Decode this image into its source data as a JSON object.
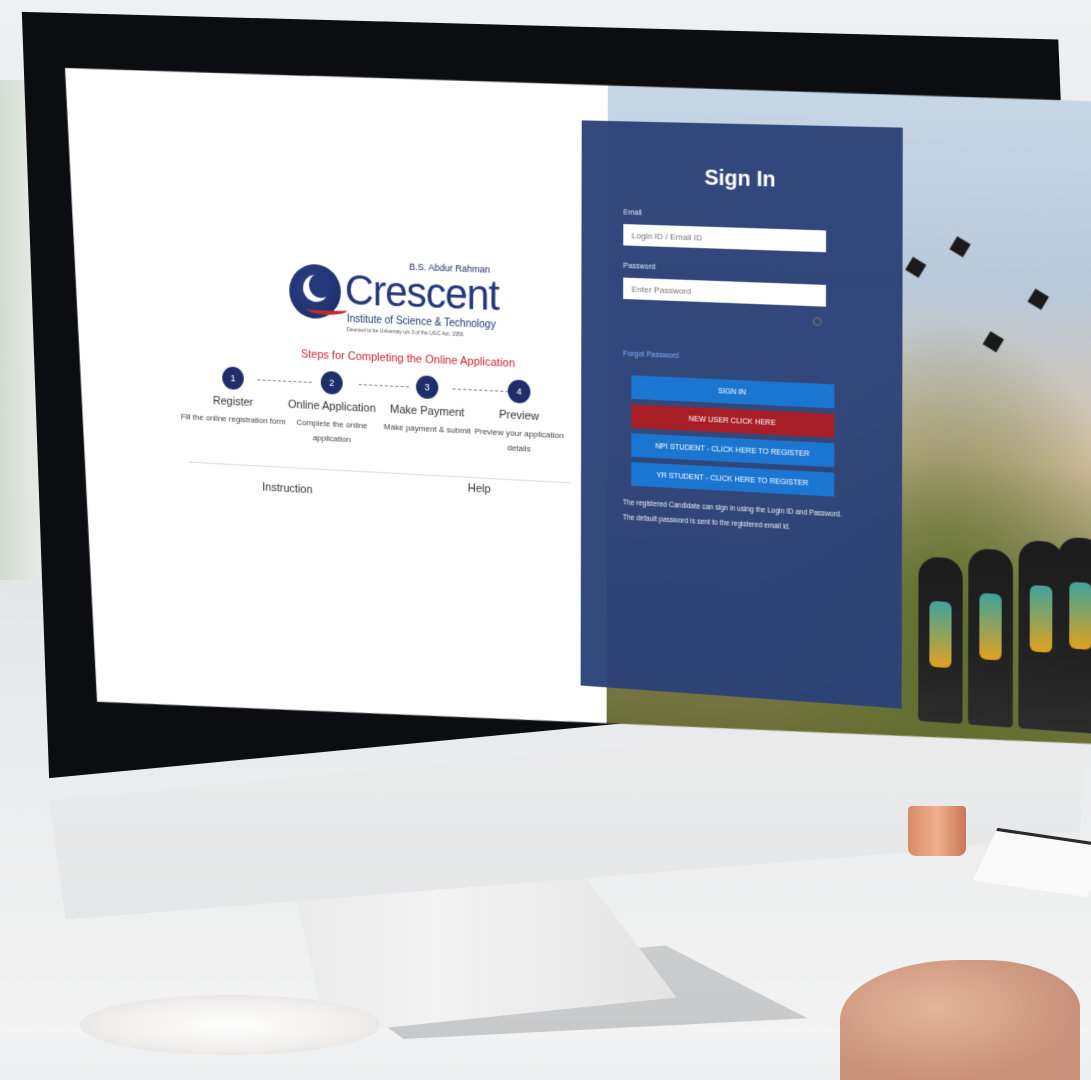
{
  "left": {
    "logo": {
      "top_line": "B.S. Abdur Rahman",
      "name": "Crescent",
      "subtitle": "Institute of Science & Technology",
      "deemed": "Deemed to be University u/s 3 of the UGC Act, 1956"
    },
    "steps_heading": "Steps for Completing the Online Application",
    "steps": [
      {
        "number": "1",
        "title": "Register",
        "desc": "Fill the online registration form"
      },
      {
        "number": "2",
        "title": "Online Application",
        "desc": "Complete the online application"
      },
      {
        "number": "3",
        "title": "Make Payment",
        "desc": "Make payment & submit"
      },
      {
        "number": "4",
        "title": "Preview",
        "desc": "Preview your application details"
      }
    ],
    "tabs": {
      "instruction": "Instruction",
      "help": "Help"
    }
  },
  "signin": {
    "title": "Sign In",
    "email_label": "Email",
    "email_placeholder": "Login ID / Email ID",
    "password_label": "Password",
    "password_placeholder": "Enter Password",
    "forgot": "Forgot Password",
    "btn_signin": "SIGN IN",
    "btn_newuser": "NEW USER CLICK HERE",
    "btn_npi": "NPI STUDENT - CLICK HERE TO REGISTER",
    "btn_yr": "YR STUDENT - CLICK HERE TO REGISTER",
    "note": "The registered Candidate can sign in using the Login ID and Password. The default password is sent to the registered email id."
  },
  "colors": {
    "panel": "#2c4278",
    "signin_button": "#1b76d1",
    "newuser_button": "#a81e27",
    "brand": "#24377a",
    "steps_heading": "#c5282f"
  }
}
